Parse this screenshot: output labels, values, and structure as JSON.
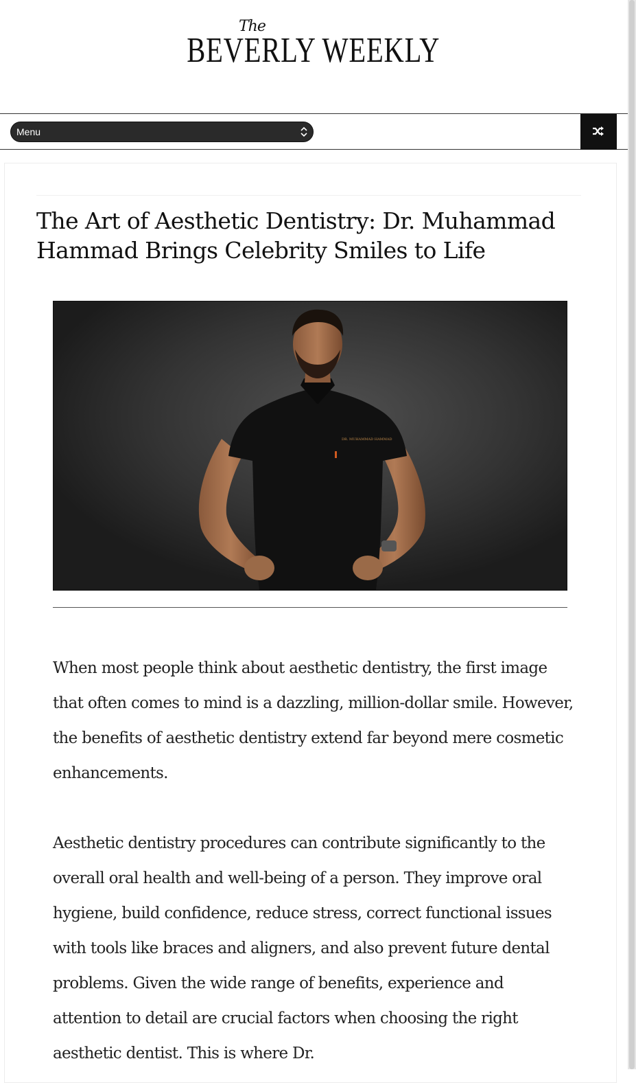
{
  "site": {
    "logo_the": "The",
    "logo_name": "BEVERLY WEEKLY"
  },
  "nav": {
    "menu_label": "Menu",
    "random_icon": "shuffle-icon"
  },
  "article": {
    "title": "The Art of Aesthetic Dentistry: Dr. Muhammad Hammad Brings Celebrity Smiles to Life",
    "image_alt": "Dr. Muhammad Hammad portrait",
    "shirt_text": "DR. MUHAMMAD HAMMAD",
    "paragraphs": [
      "When most people think about aesthetic dentistry, the first image that often comes to mind is a dazzling, million-dollar smile. However, the benefits of aesthetic dentistry extend far beyond mere cosmetic enhancements.",
      "Aesthetic dentistry procedures can contribute significantly to the overall oral health and well-being of a person. They improve oral hygiene, build confidence, reduce stress, correct functional issues with tools like braces and aligners, and also prevent future dental problems. Given the wide range of benefits, experience and attention to detail are crucial factors when choosing the right aesthetic dentist. This is where Dr."
    ]
  },
  "colors": {
    "nav_bar_bg": "#2a2a2a",
    "random_button_bg": "#111111",
    "text": "#222222"
  }
}
